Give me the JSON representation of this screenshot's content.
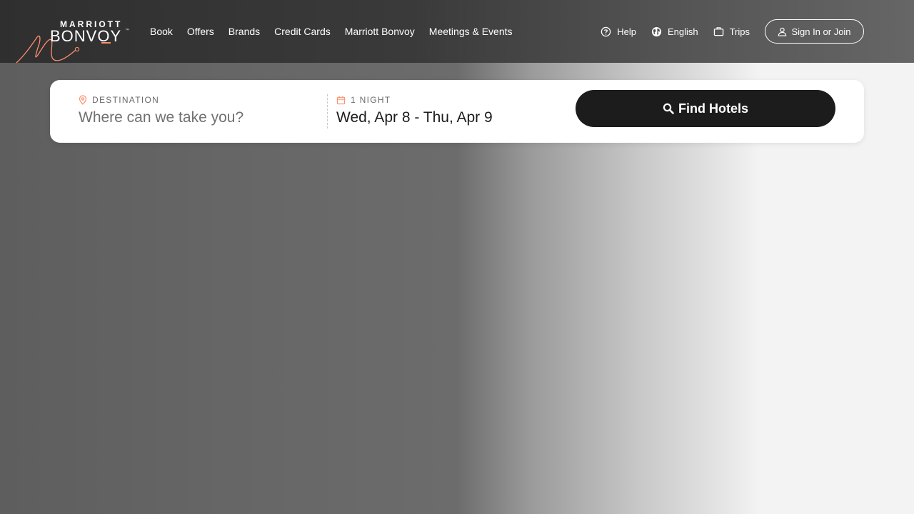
{
  "brand": {
    "logo_top": "MARRIOTT",
    "logo_main": "BONVOY",
    "logo_tm": "™",
    "accent_color": "#ff8d6b"
  },
  "nav": {
    "items": [
      {
        "label": "Book"
      },
      {
        "label": "Offers"
      },
      {
        "label": "Brands"
      },
      {
        "label": "Credit Cards"
      },
      {
        "label": "Marriott Bonvoy"
      },
      {
        "label": "Meetings & Events"
      }
    ]
  },
  "utility": {
    "help": {
      "label": "Help",
      "icon": "help-circle-icon"
    },
    "language": {
      "label": "English",
      "icon": "globe-icon"
    },
    "trips": {
      "label": "Trips",
      "icon": "suitcase-icon"
    },
    "signin": {
      "label": "Sign In or Join",
      "icon": "user-icon"
    }
  },
  "search": {
    "destination": {
      "label": "DESTINATION",
      "placeholder": "Where can we take you?",
      "value": "",
      "icon": "map-pin-icon"
    },
    "dates": {
      "label": "1 NIGHT",
      "value": "Wed, Apr 8 - Thu, Apr 9",
      "icon": "calendar-icon"
    },
    "submit": {
      "label": "Find Hotels",
      "icon": "search-icon"
    }
  }
}
